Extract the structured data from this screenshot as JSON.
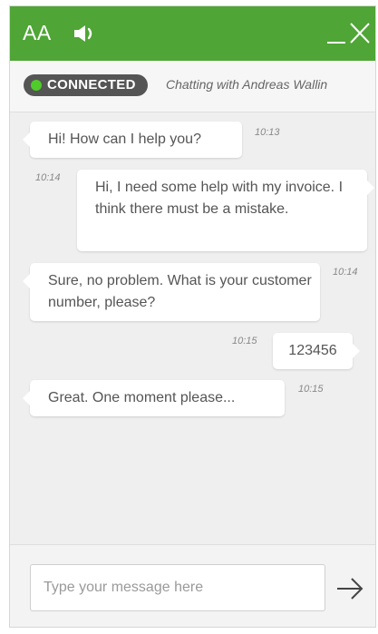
{
  "header": {
    "font_size_label": "AA",
    "color": "#4fa535"
  },
  "status": {
    "badge_label": "CONNECTED",
    "agent_text": "Chatting with Andreas Wallin",
    "dot_color": "#4fcb2a"
  },
  "messages": [
    {
      "sender": "agent",
      "text": "Hi! How can I help you?",
      "time": "10:13"
    },
    {
      "sender": "user",
      "text": "Hi, I need some help with my invoice. I think there must be a mistake.",
      "time": "10:14"
    },
    {
      "sender": "agent",
      "text": "Sure, no problem. What is your customer number, please?",
      "time": "10:14"
    },
    {
      "sender": "user",
      "text": "123456",
      "time": "10:15"
    },
    {
      "sender": "agent",
      "text": "Great. One moment please...",
      "time": "10:15"
    }
  ],
  "input": {
    "placeholder": "Type your message here",
    "value": ""
  },
  "icons": {
    "speaker": "speaker-icon",
    "minimize": "minimize-icon",
    "close": "close-icon",
    "send": "arrow-right-icon"
  }
}
